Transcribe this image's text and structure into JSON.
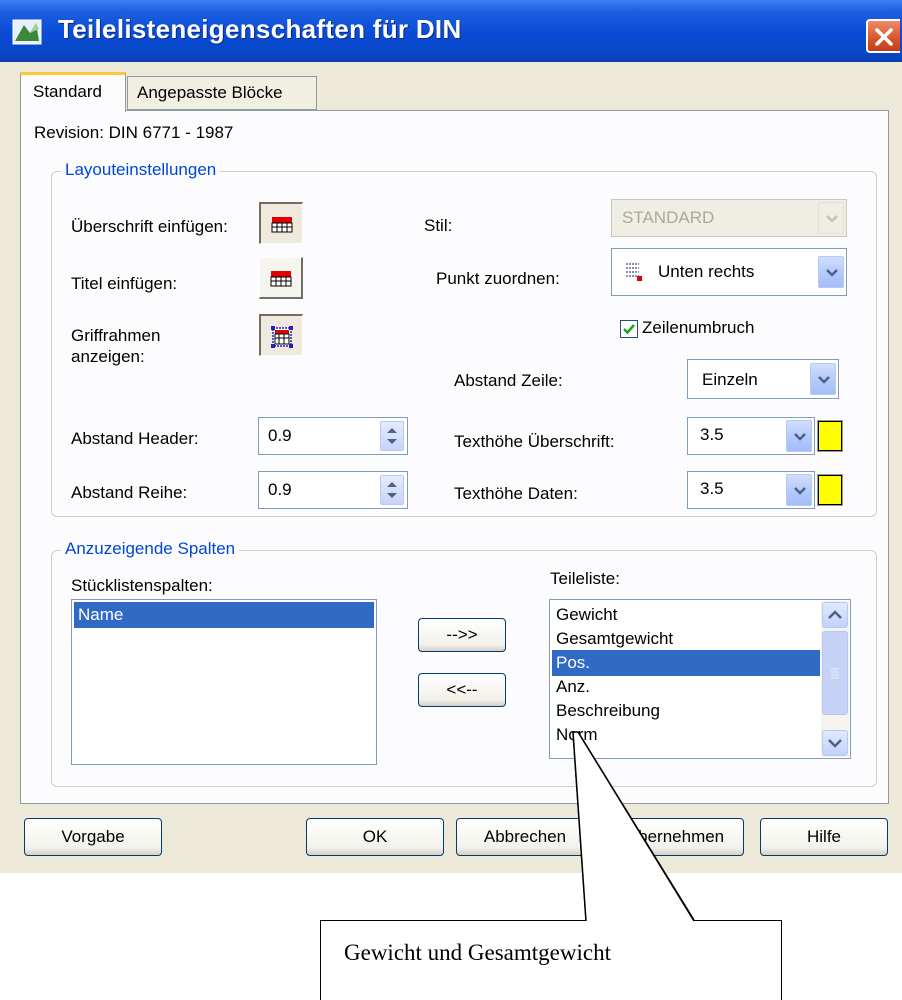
{
  "window": {
    "title": "Teilelisteneigenschaften für DIN"
  },
  "tabs": {
    "standard": "Standard",
    "custom_blocks": "Angepasste Blöcke"
  },
  "revision": "Revision: DIN 6771 - 1987",
  "layout": {
    "legend": "Layouteinstellungen",
    "header_insert_label": "Überschrift einfügen:",
    "title_insert_label": "Titel einfügen:",
    "grip_label_line1": "Griffrahmen",
    "grip_label_line2": "anzeigen:",
    "style_label": "Stil:",
    "style_value": "STANDARD",
    "point_label": "Punkt zuordnen:",
    "point_value": "Unten rechts",
    "wrap_label": "Zeilenumbruch",
    "wrap_checked": true,
    "line_spacing_label": "Abstand Zeile:",
    "line_spacing_value": "Einzeln",
    "header_spacing_label": "Abstand Header:",
    "header_spacing_value": "0.9",
    "row_spacing_label": "Abstand Reihe:",
    "row_spacing_value": "0.9",
    "header_text_height_label": "Texthöhe Überschrift:",
    "header_text_height_value": "3.5",
    "data_text_height_label": "Texthöhe Daten:",
    "data_text_height_value": "3.5",
    "text_color": "#ffff00"
  },
  "columns": {
    "legend": "Anzuzeigende Spalten",
    "bom_label": "Stücklistenspalten:",
    "bom_items": [
      "Name"
    ],
    "parts_label": "Teileliste:",
    "parts_items": [
      "Gewicht",
      "Gesamtgewicht",
      "Pos.",
      "Anz.",
      "Beschreibung",
      "Norm"
    ],
    "parts_selected": "Pos.",
    "add_button": "-->>",
    "remove_button": "<<--"
  },
  "buttons": {
    "default": "Vorgabe",
    "ok": "OK",
    "cancel": "Abbrechen",
    "apply": "Übernehmen",
    "help": "Hilfe"
  },
  "annotation": {
    "text": "Gewicht und Gesamtgewicht"
  },
  "colors": {
    "titlebar": "#0a4bd6",
    "dialog_bg": "#ece9d8",
    "selection": "#316ac5",
    "group_legend": "#0046d5",
    "close": "#d6542e"
  }
}
